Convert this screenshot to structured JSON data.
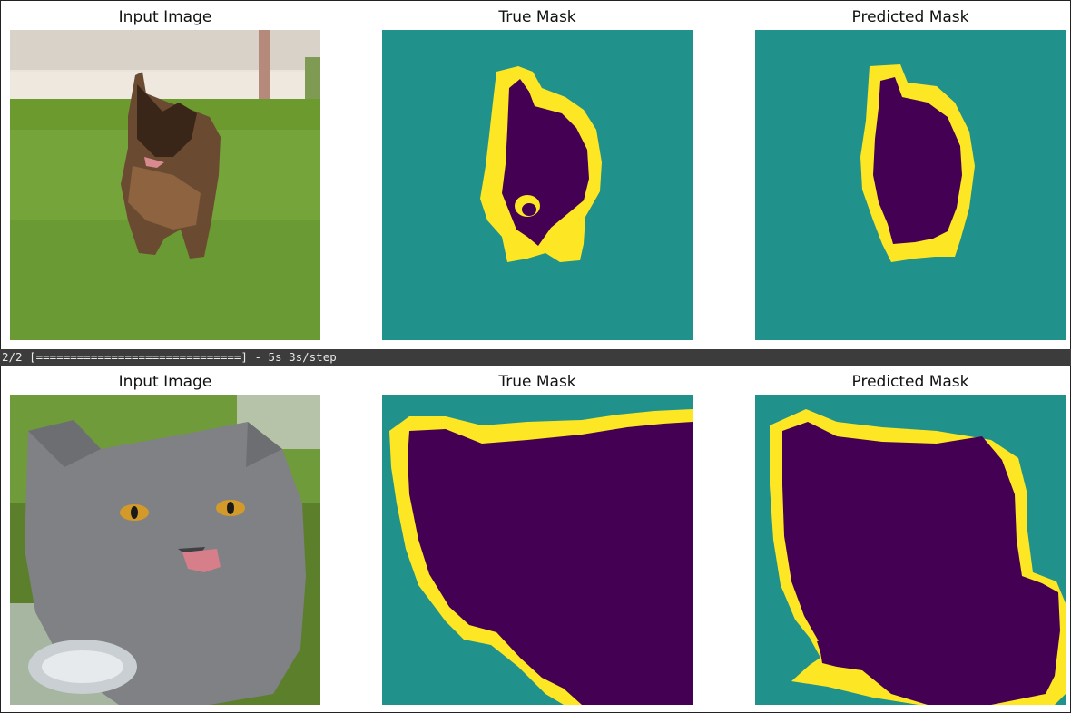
{
  "figures": [
    {
      "titles": [
        "Input Image",
        "True Mask",
        "Predicted Mask"
      ],
      "input_subject": "dog running on grass"
    },
    {
      "titles": [
        "Input Image",
        "True Mask",
        "Predicted Mask"
      ],
      "input_subject": "grey cat sticking out tongue"
    }
  ],
  "progress": {
    "text": "2/2 [==============================] - 5s 3s/step"
  },
  "colors": {
    "background": "#21918c",
    "border": "#fde725",
    "object": "#440154",
    "progress_bg": "#3c3c3c"
  }
}
